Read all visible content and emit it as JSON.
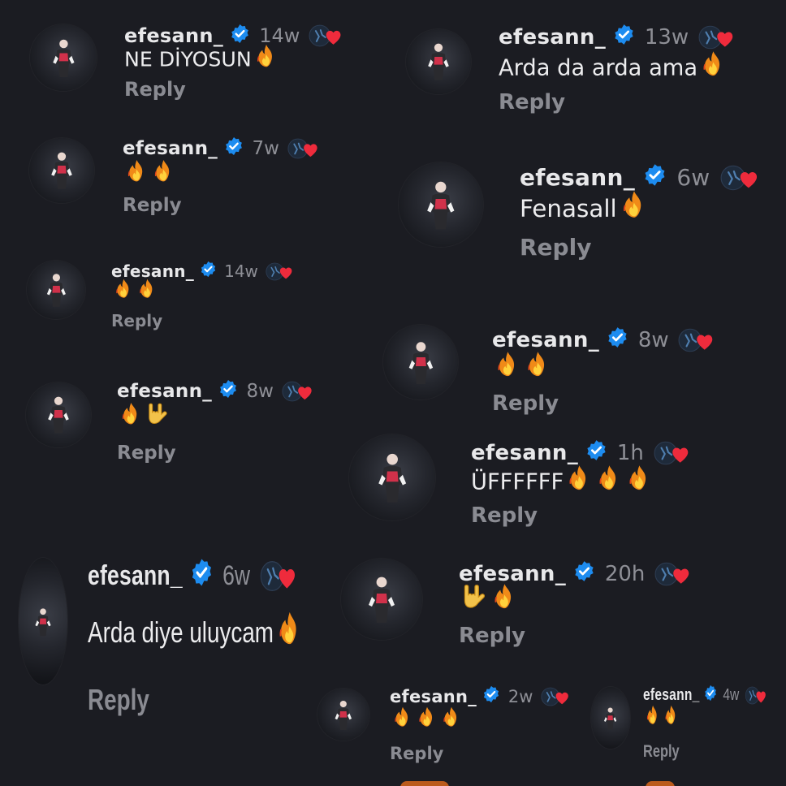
{
  "comments": [
    {
      "username": "efesann_",
      "time": "14w",
      "text": "NE DİYOSUN",
      "emojis": [
        "fire"
      ],
      "reply": "Reply"
    },
    {
      "username": "efesann_",
      "time": "13w",
      "text": "Arda da arda ama",
      "emojis": [
        "fire"
      ],
      "reply": "Reply"
    },
    {
      "username": "efesann_",
      "time": "7w",
      "text": "",
      "emojis": [
        "fire",
        "fire"
      ],
      "reply": "Reply"
    },
    {
      "username": "efesann_",
      "time": "6w",
      "text": "Fenasall",
      "emojis": [
        "fire"
      ],
      "reply": "Reply"
    },
    {
      "username": "efesann_",
      "time": "14w",
      "text": "",
      "emojis": [
        "fire",
        "fire"
      ],
      "reply": "Reply"
    },
    {
      "username": "efesann_",
      "time": "8w",
      "text": "",
      "emojis": [
        "fire",
        "fire"
      ],
      "reply": "Reply"
    },
    {
      "username": "efesann_",
      "time": "8w",
      "text": "",
      "emojis": [
        "fire",
        "rock-hand"
      ],
      "reply": "Reply"
    },
    {
      "username": "efesann_",
      "time": "1h",
      "text": "ÜFFFFFF",
      "emojis": [
        "fire",
        "fire",
        "fire"
      ],
      "reply": "Reply"
    },
    {
      "username": "efesann_",
      "time": "6w",
      "text": "Arda diye uluycam",
      "emojis": [
        "fire"
      ],
      "reply": "Reply"
    },
    {
      "username": "efesann_",
      "time": "20h",
      "text": "",
      "emojis": [
        "rock-hand",
        "fire"
      ],
      "reply": "Reply"
    },
    {
      "username": "efesann_",
      "time": "2w",
      "text": "",
      "emojis": [
        "fire",
        "fire",
        "fire"
      ],
      "reply": "Reply"
    },
    {
      "username": "efesann_",
      "time": "4w",
      "text": "",
      "emojis": [
        "fire",
        "fire"
      ],
      "reply": "Reply"
    }
  ],
  "icons": {
    "verified": "verified-badge-icon",
    "creator_like": "creator-avatar-heart-icon",
    "fire": "fire-emoji-icon",
    "rock_hand": "rock-hand-emoji-icon"
  },
  "colors": {
    "background": "#1b1c22",
    "username": "#e8e8ea",
    "text": "#ececee",
    "meta": "#8e8f96",
    "verified": "#1d8cf0",
    "heart": "#ef2b3c"
  }
}
